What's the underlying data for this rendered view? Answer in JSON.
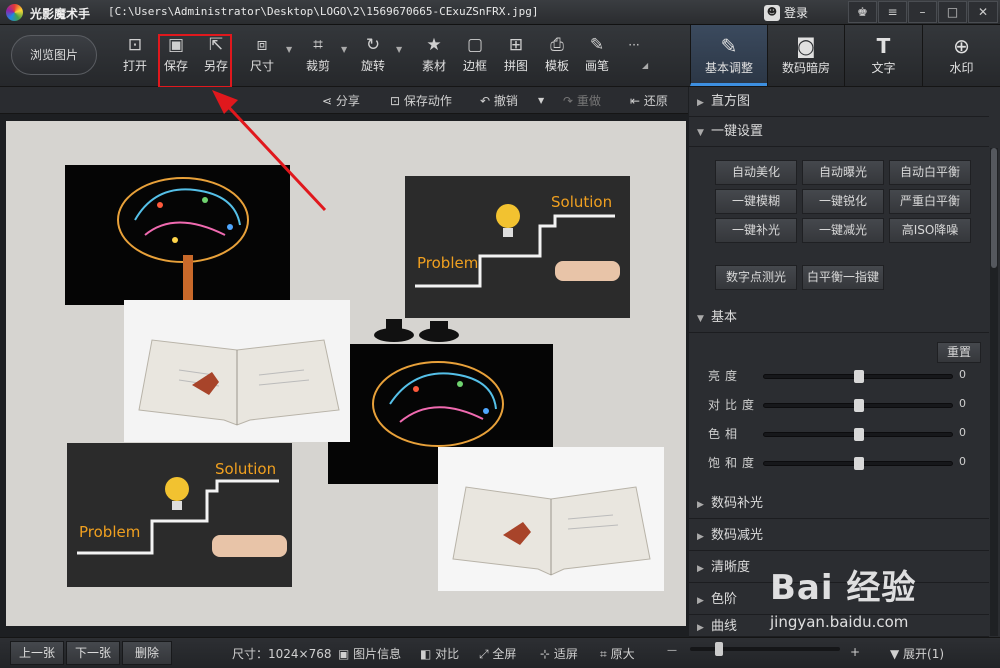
{
  "titlebar": {
    "app_title": "光影魔术手",
    "file_path": "[C:\\Users\\Administrator\\Desktop\\LOGO\\2\\1569670665-CExuZSnFRX.jpg]",
    "login_label": "登录",
    "buttons": [
      "skin-icon",
      "menu-icon",
      "minimize-icon",
      "maximize-icon",
      "close-icon"
    ]
  },
  "toolbar": {
    "browse_label": "浏览图片",
    "tools": [
      {
        "label": "打开",
        "icon": "open-icon"
      },
      {
        "label": "保存",
        "icon": "save-icon"
      },
      {
        "label": "另存",
        "icon": "save-as-icon"
      },
      {
        "label": "尺寸",
        "icon": "resize-icon"
      },
      {
        "label": "裁剪",
        "icon": "crop-icon"
      },
      {
        "label": "旋转",
        "icon": "rotate-icon"
      },
      {
        "label": "素材",
        "icon": "material-icon"
      },
      {
        "label": "边框",
        "icon": "frame-icon"
      },
      {
        "label": "拼图",
        "icon": "collage-icon"
      },
      {
        "label": "模板",
        "icon": "template-icon"
      },
      {
        "label": "画笔",
        "icon": "brush-icon"
      },
      {
        "label": "···",
        "icon": "more-icon"
      }
    ],
    "right_tabs": [
      {
        "label": "基本调整",
        "icon": "adjust-icon",
        "active": true
      },
      {
        "label": "数码暗房",
        "icon": "darkroom-icon",
        "active": false
      },
      {
        "label": "文字",
        "icon": "text-icon",
        "active": false
      },
      {
        "label": "水印",
        "icon": "watermark-icon",
        "active": false
      }
    ]
  },
  "subbar": {
    "share": "分享",
    "save_action": "保存动作",
    "undo": "撤销",
    "redo": "重做",
    "restore": "还原"
  },
  "panel": {
    "histogram": "直方图",
    "one_click": "一键设置",
    "preset_buttons": [
      "自动美化",
      "自动曝光",
      "自动白平衡",
      "一键模糊",
      "一键锐化",
      "严重白平衡",
      "一键补光",
      "一键减光",
      "高ISO降噪",
      "数字点测光",
      "白平衡一指键"
    ],
    "basic": "基本",
    "reset": "重置",
    "sliders": [
      {
        "label": "亮度",
        "value": "0"
      },
      {
        "label": "对比度",
        "value": "0"
      },
      {
        "label": "色相",
        "value": "0"
      },
      {
        "label": "饱和度",
        "value": "0"
      }
    ],
    "sections": [
      "数码补光",
      "数码减光",
      "清晰度",
      "色阶",
      "曲线"
    ]
  },
  "status": {
    "prev": "上一张",
    "next": "下一张",
    "delete": "删除",
    "size": "尺寸：1024×768",
    "info": "图片信息",
    "compare": "对比",
    "fullscreen": "全屏",
    "fit": "适屏",
    "original": "原大",
    "expand": "展开(1)"
  },
  "watermark": {
    "brand": "Bai 经验",
    "url": "jingyan.baidu.com"
  },
  "canvas": {
    "problem": "Problem",
    "solution": "Solution"
  },
  "colors": {
    "highlight": "#e0181d",
    "accent": "#3d8fe0"
  }
}
